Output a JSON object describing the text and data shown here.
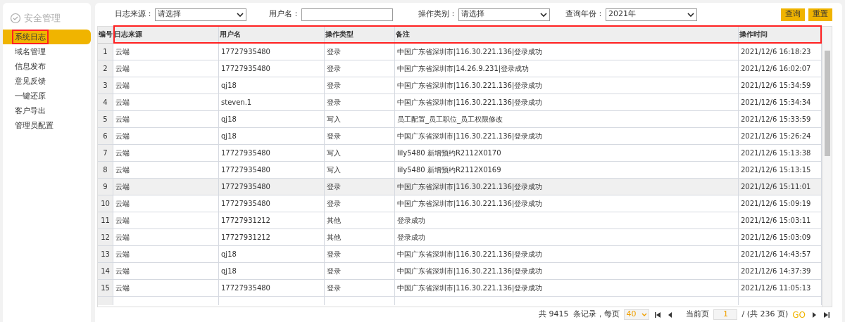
{
  "sidebar": {
    "title": "安全管理",
    "items": [
      {
        "label": "系统日志",
        "selected": true,
        "annotated": true
      },
      {
        "label": "域名管理",
        "selected": false,
        "annotated": false
      },
      {
        "label": "信息发布",
        "selected": false,
        "annotated": false
      },
      {
        "label": "意见反馈",
        "selected": false,
        "annotated": false
      },
      {
        "label": "一键还原",
        "selected": false,
        "annotated": false
      },
      {
        "label": "客户导出",
        "selected": false,
        "annotated": false
      },
      {
        "label": "管理员配置",
        "selected": false,
        "annotated": false
      }
    ]
  },
  "filters": [
    {
      "kind": "select",
      "label": "日志来源：",
      "value": "请选择"
    },
    {
      "kind": "input",
      "label": "用户名："
    },
    {
      "kind": "select",
      "label": "操作类别：",
      "value": "请选择"
    },
    {
      "kind": "select",
      "label": "查询年份：",
      "value": "2021年"
    }
  ],
  "buttons": [
    "查询",
    "重置"
  ],
  "table": {
    "header_annotated": true,
    "columns": [
      "编号",
      "日志来源",
      "用户名",
      "操作类型",
      "备注",
      "操作时间"
    ],
    "rows": [
      {
        "cells": [
          "1",
          "云端",
          "17727935480",
          "登录",
          "中国广东省深圳市|116.30.221.136|登录成功",
          "2021/12/6 16:18:23"
        ],
        "selected": false
      },
      {
        "cells": [
          "2",
          "云端",
          "17727935480",
          "登录",
          "中国广东省深圳市|14.26.9.231|登录成功",
          "2021/12/6 16:02:07"
        ],
        "selected": false
      },
      {
        "cells": [
          "3",
          "云端",
          "qj18",
          "登录",
          "中国广东省深圳市|116.30.221.136|登录成功",
          "2021/12/6 15:34:59"
        ],
        "selected": false
      },
      {
        "cells": [
          "4",
          "云端",
          "steven.1",
          "登录",
          "中国广东省深圳市|116.30.221.136|登录成功",
          "2021/12/6 15:34:34"
        ],
        "selected": false
      },
      {
        "cells": [
          "5",
          "云端",
          "qj18",
          "写入",
          "员工配置_员工职位_员工权限修改",
          "2021/12/6 15:33:59"
        ],
        "selected": false
      },
      {
        "cells": [
          "6",
          "云端",
          "qj18",
          "登录",
          "中国广东省深圳市|116.30.221.136|登录成功",
          "2021/12/6 15:26:24"
        ],
        "selected": false
      },
      {
        "cells": [
          "7",
          "云端",
          "17727935480",
          "写入",
          "lily5480 新增预约R2112X0170",
          "2021/12/6 15:13:38"
        ],
        "selected": false
      },
      {
        "cells": [
          "8",
          "云端",
          "17727935480",
          "写入",
          "lily5480 新增预约R2112X0169",
          "2021/12/6 15:13:15"
        ],
        "selected": false
      },
      {
        "cells": [
          "9",
          "云端",
          "17727935480",
          "登录",
          "中国广东省深圳市|116.30.221.136|登录成功",
          "2021/12/6 15:11:01"
        ],
        "selected": true
      },
      {
        "cells": [
          "10",
          "云端",
          "17727935480",
          "登录",
          "中国广东省深圳市|116.30.221.136|登录成功",
          "2021/12/6 15:09:19"
        ],
        "selected": false
      },
      {
        "cells": [
          "11",
          "云端",
          "17727931212",
          "其他",
          "登录成功",
          "2021/12/6 15:03:11"
        ],
        "selected": false
      },
      {
        "cells": [
          "12",
          "云端",
          "17727931212",
          "其他",
          "登录成功",
          "2021/12/6 15:03:09"
        ],
        "selected": false
      },
      {
        "cells": [
          "13",
          "云端",
          "qj18",
          "登录",
          "中国广东省深圳市|116.30.221.136|登录成功",
          "2021/12/6 14:43:57"
        ],
        "selected": false
      },
      {
        "cells": [
          "14",
          "云端",
          "qj18",
          "登录",
          "中国广东省深圳市|116.30.221.136|登录成功",
          "2021/12/6 14:37:39"
        ],
        "selected": false
      },
      {
        "cells": [
          "15",
          "云端",
          "17727935480",
          "登录",
          "中国广东省深圳市|116.30.221.136|登录成功",
          "2021/12/6 11:05:13"
        ],
        "selected": false
      }
    ]
  },
  "pagination": {
    "summary": "共 9415  条记录，每页",
    "page_size": "40",
    "current_label": "当前页",
    "current_page": "1",
    "total": "/ (共 236 页)",
    "go": "GO"
  }
}
